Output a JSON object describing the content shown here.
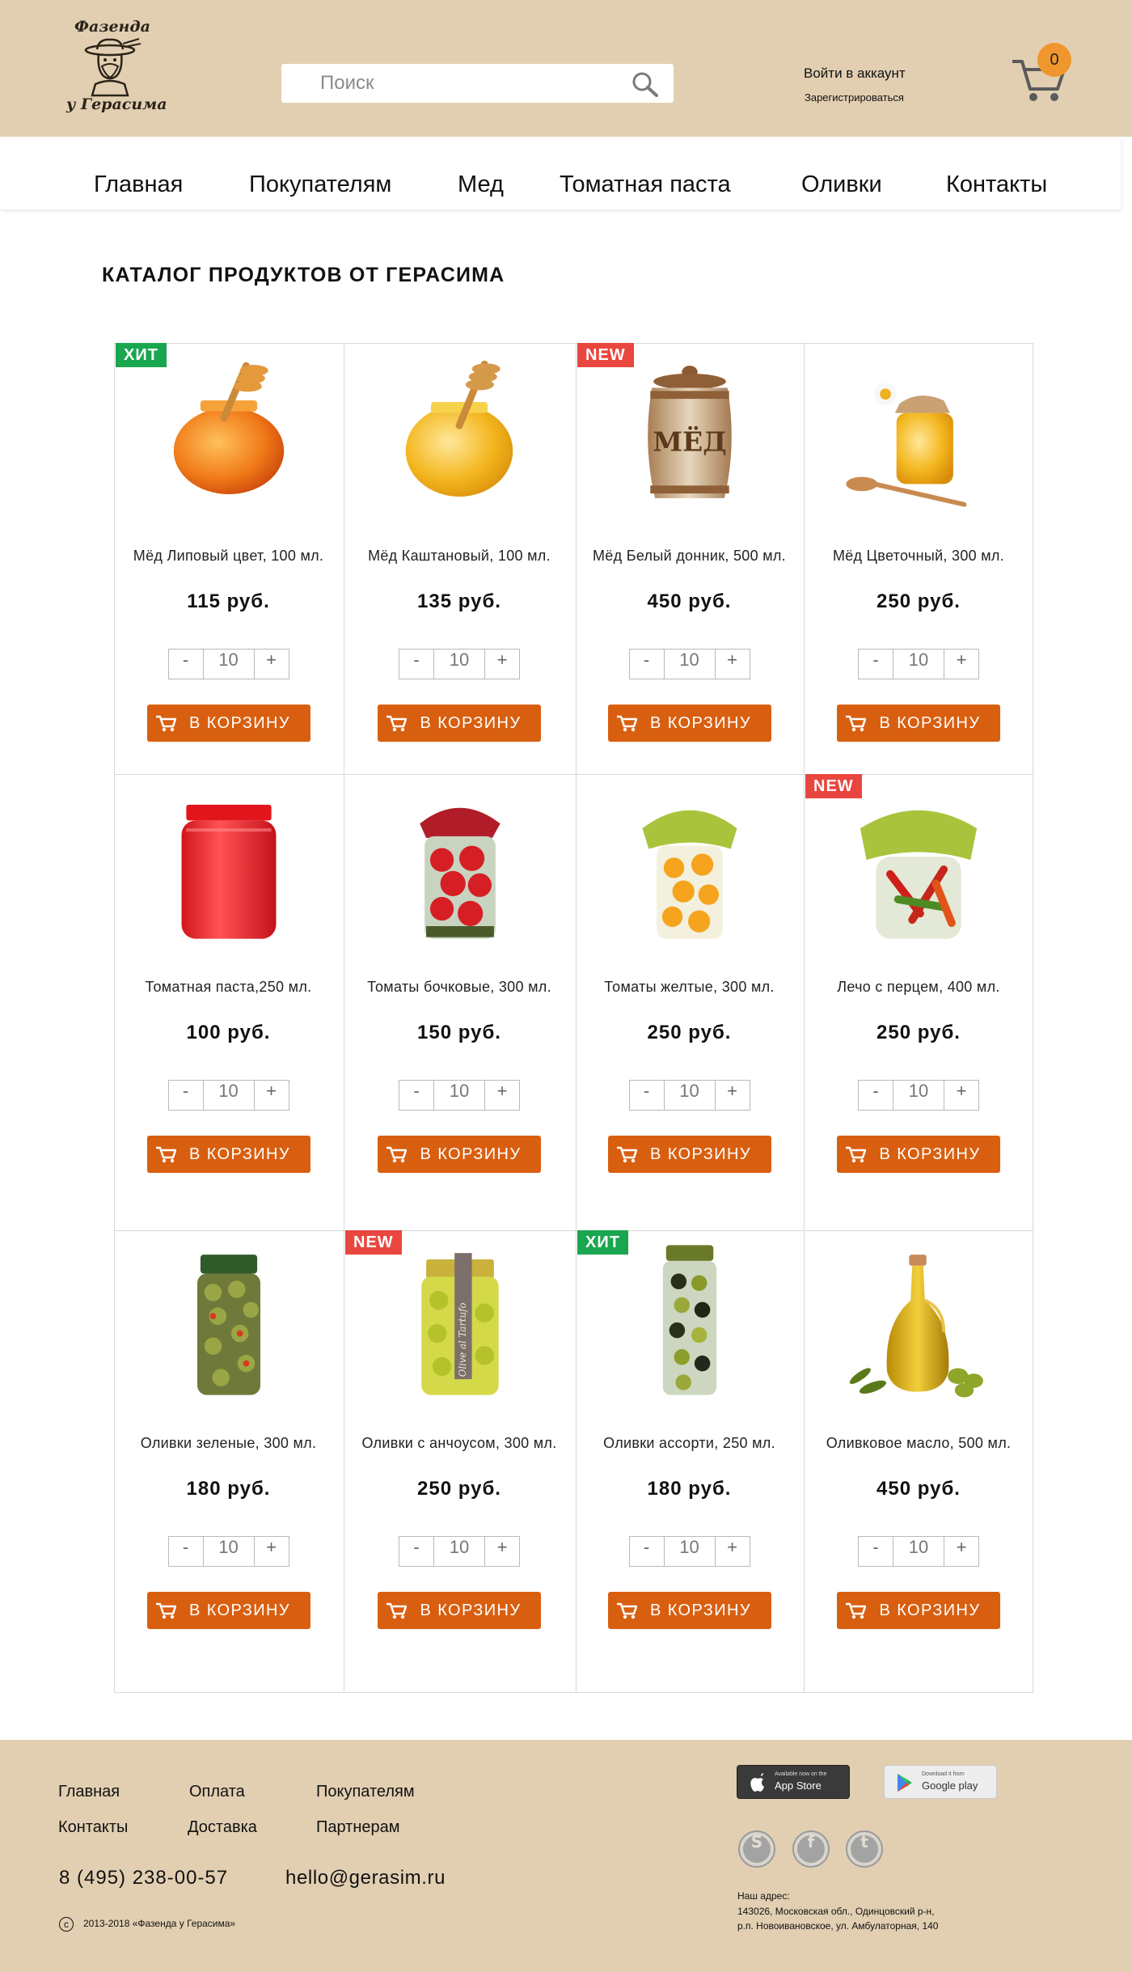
{
  "colors": {
    "header_bg": "#e2cfb2",
    "accent_button": "#d95f10",
    "cart_badge": "#f0962f",
    "badge_hit": "#1aa64f",
    "badge_new": "#e9463f"
  },
  "header": {
    "logo_top": "Фазенда",
    "logo_bottom": "у Герасима",
    "search_placeholder": "Поиск",
    "login": "Войти в аккаунт",
    "register": "Зарегистрироваться",
    "cart_count": "0",
    "icons": [
      "farmer-logo-icon",
      "search-icon",
      "cart-icon"
    ]
  },
  "nav": [
    "Главная",
    "Покупателям",
    "Мед",
    "Томатная паста",
    "Оливки",
    "Контакты"
  ],
  "catalog": {
    "title": "КАТАЛОГ ПРОДУКТОВ ОТ ГЕРАСИМА",
    "add_label": "В КОРЗИНУ",
    "minus": "-",
    "plus": "+",
    "products": [
      {
        "name": "Мёд Липовый цвет, 100 мл.",
        "price": "115 руб.",
        "qty": "10",
        "badge": "ХИТ",
        "badge_type": "hit",
        "image": "honey-jar-dipper"
      },
      {
        "name": "Мёд Каштановый, 100 мл.",
        "price": "135 руб.",
        "qty": "10",
        "badge": "",
        "badge_type": "",
        "image": "honey-jar-dipper-yellow"
      },
      {
        "name": "Мёд Белый донник, 500 мл.",
        "price": "450 руб.",
        "qty": "10",
        "badge": "NEW",
        "badge_type": "new",
        "image": "ceramic-honey-barrel"
      },
      {
        "name": "Мёд Цветочный, 300 мл.",
        "price": "250 руб.",
        "qty": "10",
        "badge": "",
        "badge_type": "",
        "image": "honey-jar-flower-spoon"
      },
      {
        "name": "Томатная паста,250 мл.",
        "price": "100 руб.",
        "qty": "10",
        "badge": "",
        "badge_type": "",
        "image": "tomato-paste-jar"
      },
      {
        "name": "Томаты бочковые, 300 мл.",
        "price": "150 руб.",
        "qty": "10",
        "badge": "",
        "badge_type": "",
        "image": "pickled-tomatoes-jar"
      },
      {
        "name": "Томаты желтые, 300 мл.",
        "price": "250 руб.",
        "qty": "10",
        "badge": "",
        "badge_type": "",
        "image": "yellow-tomatoes-jar"
      },
      {
        "name": "Лечо с перцем, 400 мл.",
        "price": "250 руб.",
        "qty": "10",
        "badge": "NEW",
        "badge_type": "new",
        "image": "lecho-pepper-jar"
      },
      {
        "name": "Оливки зеленые, 300 мл.",
        "price": "180 руб.",
        "qty": "10",
        "badge": "",
        "badge_type": "",
        "image": "green-olives-jar"
      },
      {
        "name": "Оливки с анчоусом, 300 мл.",
        "price": "250 руб.",
        "qty": "10",
        "badge": "NEW",
        "badge_type": "new",
        "image": "olives-anchovy-jar"
      },
      {
        "name": "Оливки ассорти, 250 мл.",
        "price": "180 руб.",
        "qty": "10",
        "badge": "ХИТ",
        "badge_type": "hit",
        "image": "mixed-olives-jar"
      },
      {
        "name": "Оливковое масло, 500 мл.",
        "price": "450 руб.",
        "qty": "10",
        "badge": "",
        "badge_type": "",
        "image": "olive-oil-bottle"
      }
    ]
  },
  "footer": {
    "links": [
      "Главная",
      "Оплата",
      "Покупателям",
      "Контакты",
      "Доставка",
      "Партнерам"
    ],
    "phone": "8 (495) 238-00-57",
    "email": "hello@gerasim.ru",
    "copyright": "2013-2018 «Фазенда у Герасима»",
    "app_store_small": "Available now on the",
    "app_store": "App Store",
    "google_small": "Download it from",
    "google": "Google play",
    "address_label": "Наш адрес:",
    "address_line1": "143026, Московская обл., Одинцовский р-н,",
    "address_line2": "р.п. Новоивановское, ул. Амбулаторная, 140",
    "social": [
      "skype-icon",
      "facebook-icon",
      "twitter-icon"
    ]
  }
}
